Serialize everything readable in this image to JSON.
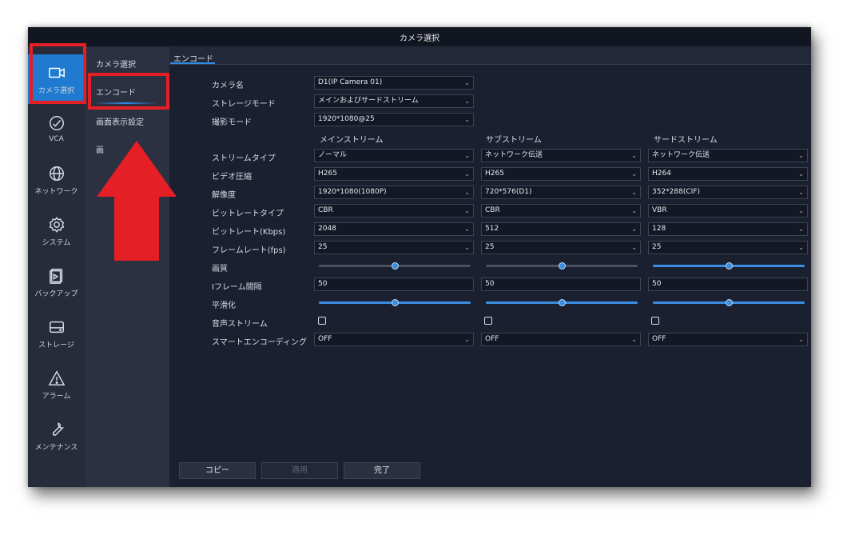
{
  "window": {
    "title": "カメラ選択"
  },
  "nav": {
    "items": [
      {
        "label": "カメラ選択",
        "icon": "camera-icon",
        "active": true
      },
      {
        "label": "VCA",
        "icon": "vca-icon"
      },
      {
        "label": "ネットワーク",
        "icon": "globe-icon"
      },
      {
        "label": "システム",
        "icon": "gear-icon"
      },
      {
        "label": "バックアップ",
        "icon": "backup-icon"
      },
      {
        "label": "ストレージ",
        "icon": "storage-icon"
      },
      {
        "label": "アラーム",
        "icon": "warning-icon"
      },
      {
        "label": "メンテナンス",
        "icon": "wrench-icon"
      }
    ]
  },
  "submenu": {
    "items": [
      {
        "label": "カメラ選択"
      },
      {
        "label": "エンコード",
        "active": true
      },
      {
        "label": "画面表示設定"
      },
      {
        "label": "画"
      }
    ]
  },
  "tab": {
    "label": "エンコード"
  },
  "form": {
    "camera_name": {
      "label": "カメラ名",
      "value": "D1(IP Camera 01)"
    },
    "storage_mode": {
      "label": "ストレージモード",
      "value": "メインおよびサードストリーム"
    },
    "capture_mode": {
      "label": "撮影モード",
      "value": "1920*1080@25"
    },
    "columns": [
      "メインストリーム",
      "サブストリーム",
      "サードストリーム"
    ],
    "rows": {
      "stream_type": {
        "label": "ストリームタイプ",
        "values": [
          "ノーマル",
          "ネットワーク伝送",
          "ネットワーク伝送"
        ]
      },
      "video_compression": {
        "label": "ビデオ圧縮",
        "values": [
          "H265",
          "H265",
          "H264"
        ]
      },
      "resolution": {
        "label": "解像度",
        "values": [
          "1920*1080(1080P)",
          "720*576(D1)",
          "352*288(CIF)"
        ]
      },
      "bitrate_type": {
        "label": "ビットレートタイプ",
        "values": [
          "CBR",
          "CBR",
          "VBR"
        ]
      },
      "bitrate": {
        "label": "ビットレート(Kbps)",
        "values": [
          "2048",
          "512",
          "128"
        ]
      },
      "frame_rate": {
        "label": "フレームレート(fps)",
        "values": [
          "25",
          "25",
          "25"
        ]
      },
      "quality": {
        "label": "画質",
        "levels": [
          0.5,
          0.5,
          0.5
        ],
        "filled": [
          false,
          false,
          true
        ]
      },
      "iframe_interval": {
        "label": "Iフレーム間隔",
        "values": [
          "50",
          "50",
          "50"
        ]
      },
      "smoothing": {
        "label": "平滑化",
        "levels": [
          0.5,
          0.5,
          0.5
        ],
        "filled": [
          true,
          true,
          true
        ]
      },
      "audio_stream": {
        "label": "音声ストリーム",
        "checked": [
          false,
          false,
          false
        ]
      },
      "smart_encoding": {
        "label": "スマートエンコーディング",
        "values": [
          "OFF",
          "OFF",
          "OFF"
        ]
      }
    }
  },
  "buttons": {
    "copy": "コピー",
    "apply": "適用",
    "done": "完了"
  },
  "colors": {
    "accent": "#2f8ce6",
    "highlight_red": "#e41f26",
    "background": "#1b2030"
  }
}
